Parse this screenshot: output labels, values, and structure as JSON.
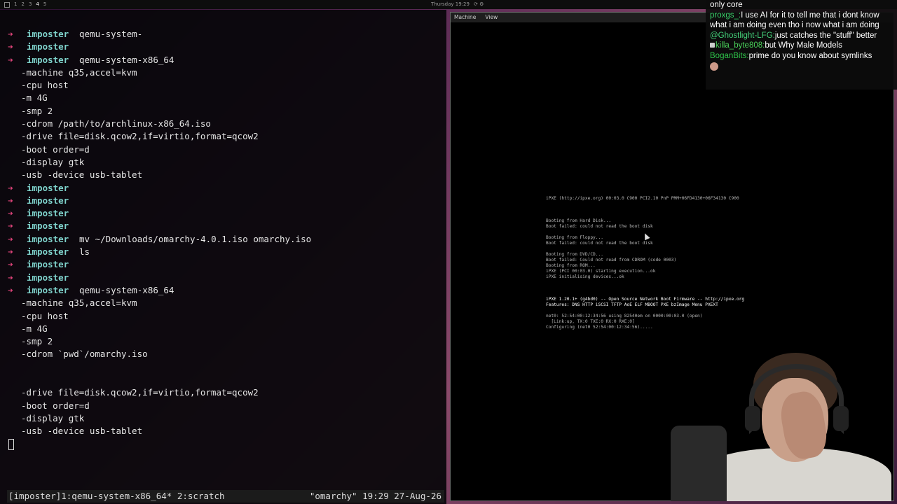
{
  "topbar": {
    "workspaces": [
      "1",
      "2",
      "3",
      "4",
      "5"
    ],
    "clock": "Thursday 19:29"
  },
  "terminal": {
    "lines": [
      {
        "type": "prompt",
        "host": "imposter",
        "cmd": "qemu-system-"
      },
      {
        "type": "prompt",
        "host": "imposter",
        "cmd": ""
      },
      {
        "type": "prompt",
        "host": "imposter",
        "cmd": "qemu-system-x86_64"
      },
      {
        "type": "cont",
        "text": "-machine q35,accel=kvm"
      },
      {
        "type": "cont",
        "text": "-cpu host"
      },
      {
        "type": "cont",
        "text": "-m 4G"
      },
      {
        "type": "cont",
        "text": "-smp 2"
      },
      {
        "type": "cont",
        "text": "-cdrom /path/to/archlinux-x86_64.iso"
      },
      {
        "type": "cont",
        "text": "-drive file=disk.qcow2,if=virtio,format=qcow2"
      },
      {
        "type": "cont",
        "text": "-boot order=d"
      },
      {
        "type": "cont",
        "text": "-display gtk"
      },
      {
        "type": "cont",
        "text": "-usb -device usb-tablet"
      },
      {
        "type": "prompt",
        "host": "imposter",
        "cmd": ""
      },
      {
        "type": "prompt",
        "host": "imposter",
        "cmd": ""
      },
      {
        "type": "prompt",
        "host": "imposter",
        "cmd": ""
      },
      {
        "type": "prompt",
        "host": "imposter",
        "cmd": ""
      },
      {
        "type": "prompt",
        "host": "imposter",
        "cmd": "mv ~/Downloads/omarchy-4.0.1.iso omarchy.iso"
      },
      {
        "type": "prompt",
        "host": "imposter",
        "cmd": "ls"
      },
      {
        "type": "prompt",
        "host": "imposter",
        "cmd": ""
      },
      {
        "type": "prompt",
        "host": "imposter",
        "cmd": ""
      },
      {
        "type": "prompt",
        "host": "imposter",
        "cmd": "qemu-system-x86_64"
      },
      {
        "type": "cont",
        "text": "-machine q35,accel=kvm"
      },
      {
        "type": "cont",
        "text": "-cpu host"
      },
      {
        "type": "cont",
        "text": "-m 4G"
      },
      {
        "type": "cont",
        "text": "-smp 2"
      },
      {
        "type": "cont",
        "text": "-cdrom `pwd`/omarchy.iso"
      },
      {
        "type": "blank"
      },
      {
        "type": "blank"
      },
      {
        "type": "cont",
        "text": "-drive file=disk.qcow2,if=virtio,format=qcow2"
      },
      {
        "type": "cont",
        "text": "-boot order=d"
      },
      {
        "type": "cont",
        "text": "-display gtk"
      },
      {
        "type": "cont",
        "text": "-usb -device usb-tablet"
      }
    ],
    "arrow": "➜",
    "status_left": "[imposter]1:qemu-system-x86_64* 2:scratch",
    "status_right": "\"omarchy\" 19:29 27-Aug-26"
  },
  "qemu": {
    "menu": [
      "Machine",
      "View"
    ],
    "boot_lines": [
      {
        "text": "iPXE (http://ipxe.org) 00:03.0 C900 PCI2.10 PnP PMM+06FD4130+06F34130 C900",
        "cls": ""
      },
      {
        "text": "",
        "cls": ""
      },
      {
        "text": "",
        "cls": ""
      },
      {
        "text": "",
        "cls": ""
      },
      {
        "text": "Booting from Hard Disk...",
        "cls": ""
      },
      {
        "text": "Boot failed: could not read the boot disk",
        "cls": ""
      },
      {
        "text": "",
        "cls": ""
      },
      {
        "text": "Booting from Floppy...",
        "cls": ""
      },
      {
        "text": "Boot failed: could not read the boot disk",
        "cls": ""
      },
      {
        "text": "",
        "cls": ""
      },
      {
        "text": "Booting from DVD/CD...",
        "cls": ""
      },
      {
        "text": "Boot failed: Could not read from CDROM (code 0003)",
        "cls": ""
      },
      {
        "text": "Booting from ROM...",
        "cls": ""
      },
      {
        "text": "iPXE (PCI 00:03.0) starting execution...ok",
        "cls": ""
      },
      {
        "text": "iPXE initialising devices...ok",
        "cls": ""
      },
      {
        "text": "",
        "cls": ""
      },
      {
        "text": "",
        "cls": ""
      },
      {
        "text": "",
        "cls": ""
      },
      {
        "text": "iPXE 1.20.1+ (g4bd0) -- Open Source Network Boot Firmware -- http://ipxe.org",
        "cls": "hl"
      },
      {
        "text": "Features: DNS HTTP iSCSI TFTP AoE ELF MBOOT PXE bzImage Menu PXEXT",
        "cls": "hl"
      },
      {
        "text": "",
        "cls": ""
      },
      {
        "text": "net0: 52:54:00:12:34:56 using 82540em on 0000:00:03.0 (open)",
        "cls": ""
      },
      {
        "text": "  [Link:up, TX:0 TXE:0 RX:0 RXE:0]",
        "cls": ""
      },
      {
        "text": "Configuring (net0 52:54:00:12:34:56).....",
        "cls": ""
      }
    ]
  },
  "chat": {
    "messages": [
      {
        "user": "",
        "color": "#ffffff",
        "text": "only core",
        "badge": false
      },
      {
        "user": "proxgs_",
        "color": "#3ad36b",
        "text": "I use AI for it to tell me that i dont know what i am doing even tho i now what i am doing",
        "badge": false
      },
      {
        "user": "@Ghostlight-LFG",
        "color": "#44d17a",
        "text": "just catches the \"stuff\" better",
        "badge": false
      },
      {
        "user": "killa_byte808",
        "color": "#4ad25a",
        "text": "but Why Male Models",
        "badge": true
      },
      {
        "user": "BoganBits",
        "color": "#2ec44a",
        "text": "prime do you know about symlinks",
        "badge": false
      }
    ]
  }
}
